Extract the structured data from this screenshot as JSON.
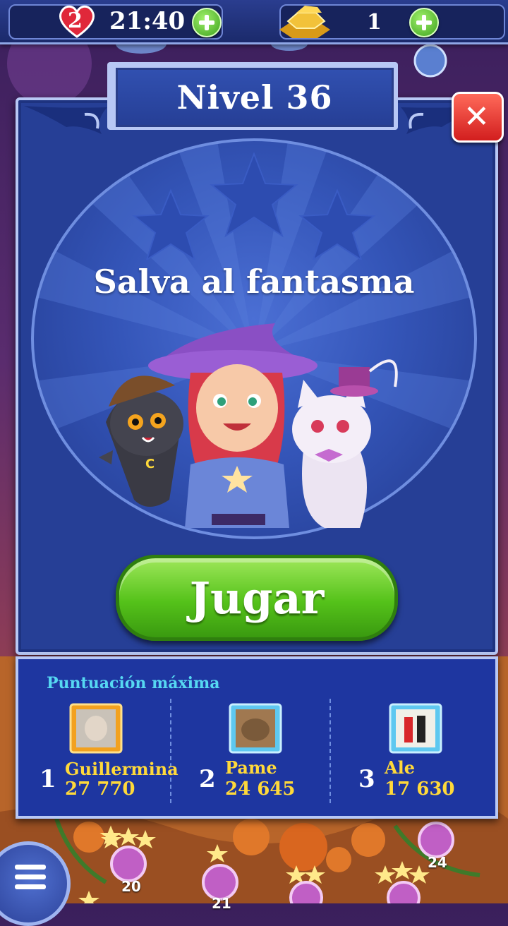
{
  "topbar": {
    "lives": "2",
    "timer": "21:40",
    "gold_bars": "1",
    "icons": [
      "heart-icon",
      "plus-icon",
      "gold-bars-icon",
      "plus-icon"
    ]
  },
  "dialog": {
    "title": "Nivel 36",
    "close_label": "✕",
    "objective": "Salva al fantasma",
    "stars_earned": 0,
    "stars_total": 3,
    "play_label": "Jugar"
  },
  "leaderboard": {
    "title": "Puntuación máxima",
    "entries": [
      {
        "rank": "1",
        "name": "Guillermina",
        "score": "27 770"
      },
      {
        "rank": "2",
        "name": "Pame",
        "score": "24 645"
      },
      {
        "rank": "3",
        "name": "Ale",
        "score": "17 630"
      }
    ]
  },
  "map": {
    "nodes": [
      "20",
      "21",
      "24"
    ]
  },
  "colors": {
    "panel_blue": "#263f96",
    "border_light": "#b8c8f5",
    "play_green": "#55c21a",
    "close_red": "#d21e1e",
    "name_yellow": "#ffd93a",
    "heading_cyan": "#56d8f2"
  }
}
